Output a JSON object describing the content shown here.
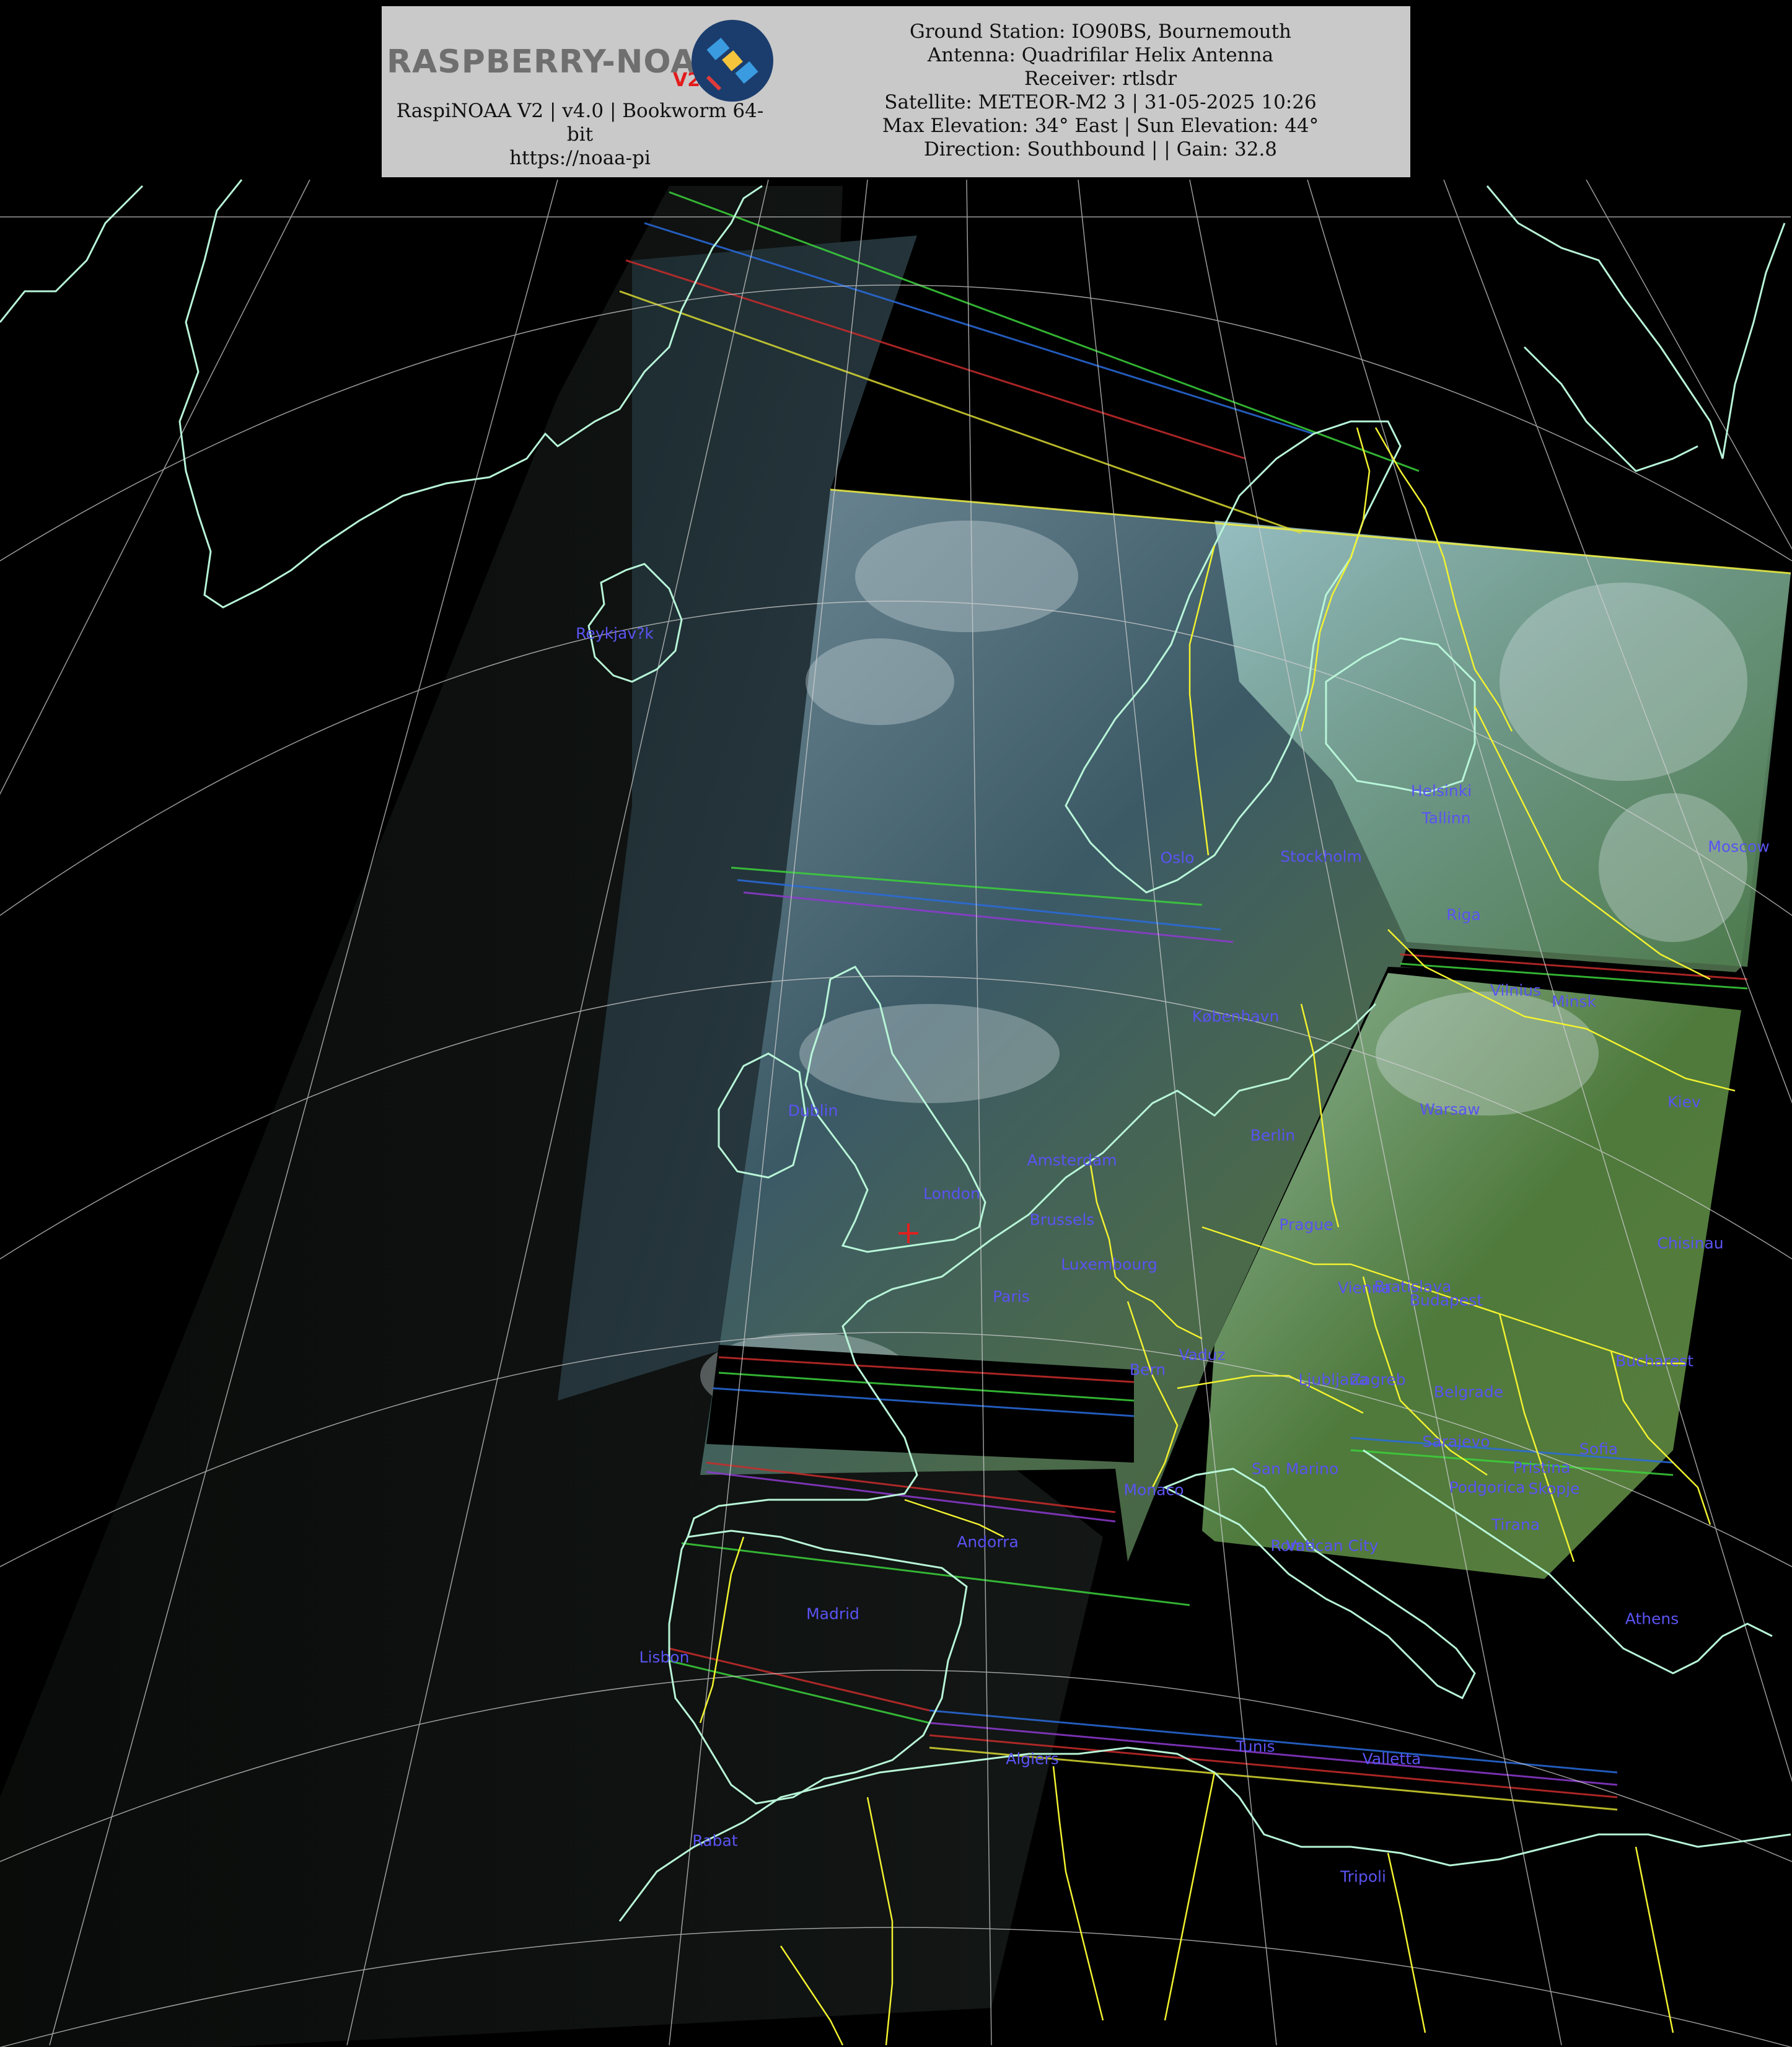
{
  "header": {
    "logo_text": "RASPBERRY-NOAA",
    "logo_version": "V2",
    "left_lines": [
      "RaspiNOAA V2 | v4.0 | Bookworm 64-",
      "bit",
      "https://noaa-pi"
    ],
    "right_lines": [
      "Ground Station: IO90BS, Bournemouth",
      "Antenna: Quadrifilar Helix Antenna",
      "Receiver: rtlsdr",
      "Satellite: METEOR-M2 3 | 31-05-2025 10:26",
      "Max Elevation: 34° East | Sun Elevation: 44°",
      "Direction: Southbound | | Gain: 32.8"
    ]
  },
  "colors": {
    "background": "#000000",
    "coastline": "#b8f5d8",
    "borders": "#f2f230",
    "graticule": "#cfcfcf",
    "city_label": "#5a53f2",
    "station_marker": "#e02020",
    "header_bg": "#c9c9c9"
  },
  "cities": [
    {
      "name": "Reykjav?k"
    },
    {
      "name": "Helsinki"
    },
    {
      "name": "Tallinn"
    },
    {
      "name": "Oslo"
    },
    {
      "name": "Stockholm"
    },
    {
      "name": "Moscow"
    },
    {
      "name": "Riga"
    },
    {
      "name": "Vilnius"
    },
    {
      "name": "Minsk"
    },
    {
      "name": "København"
    },
    {
      "name": "Dublin"
    },
    {
      "name": "Warsaw"
    },
    {
      "name": "Kiev"
    },
    {
      "name": "Berlin"
    },
    {
      "name": "Amsterdam"
    },
    {
      "name": "London"
    },
    {
      "name": "Brussels"
    },
    {
      "name": "Prague"
    },
    {
      "name": "Chisinau"
    },
    {
      "name": "Luxembourg"
    },
    {
      "name": "Paris"
    },
    {
      "name": "Vienna"
    },
    {
      "name": "Bratislava"
    },
    {
      "name": "Budapest"
    },
    {
      "name": "Vaduz"
    },
    {
      "name": "Bern"
    },
    {
      "name": "Ljubljana"
    },
    {
      "name": "Zagreb"
    },
    {
      "name": "Bucharest"
    },
    {
      "name": "Belgrade"
    },
    {
      "name": "Sarajevo"
    },
    {
      "name": "Sofia"
    },
    {
      "name": "San Marino"
    },
    {
      "name": "Pristina"
    },
    {
      "name": "Monaco"
    },
    {
      "name": "Podgorica"
    },
    {
      "name": "Skopje"
    },
    {
      "name": "Tirana"
    },
    {
      "name": "Andorra"
    },
    {
      "name": "Vatican City"
    },
    {
      "name": "Rome"
    },
    {
      "name": "Madrid"
    },
    {
      "name": "Athens"
    },
    {
      "name": "Lisbon"
    },
    {
      "name": "Tunis"
    },
    {
      "name": "Algiers"
    },
    {
      "name": "Valletta"
    },
    {
      "name": "Rabat"
    },
    {
      "name": "Tripoli"
    }
  ]
}
